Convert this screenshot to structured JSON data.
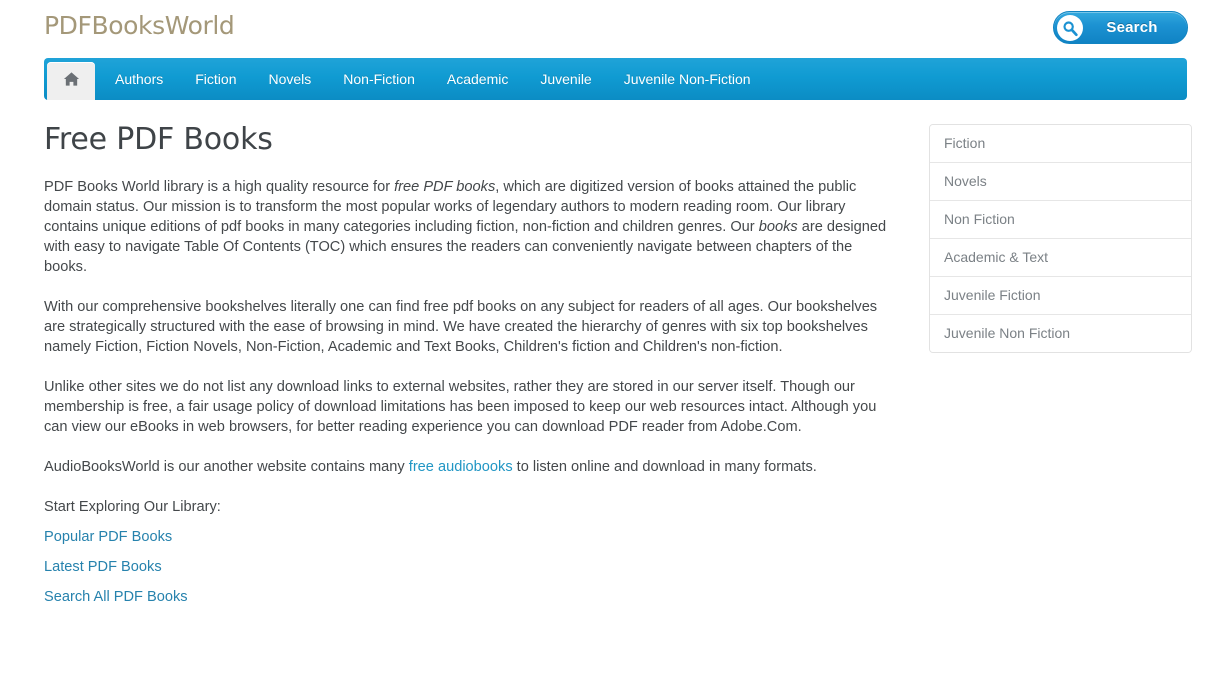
{
  "site": {
    "logo_text": "PDFBooksWorld"
  },
  "header": {
    "search_label": "Search",
    "search_icon": "search-icon"
  },
  "nav": {
    "home_icon": "home-icon",
    "items": [
      {
        "label": "Authors"
      },
      {
        "label": "Fiction"
      },
      {
        "label": "Novels"
      },
      {
        "label": "Non-Fiction"
      },
      {
        "label": "Academic"
      },
      {
        "label": "Juvenile"
      },
      {
        "label": "Juvenile Non-Fiction"
      }
    ]
  },
  "main": {
    "title": "Free PDF Books",
    "paragraph1": {
      "part1": "PDF Books World library is a high quality resource for ",
      "em1": "free PDF books",
      "part2": ", which are digitized version of books attained the public domain status. Our mission is to transform the most popular works of legendary authors to modern reading room. Our library contains unique editions of pdf books in many categories including fiction, non-fiction and children genres.  Our ",
      "em2": "books",
      "part3": " are designed with easy to navigate Table Of Contents (TOC) which ensures the readers can conveniently navigate between chapters of the books."
    },
    "paragraph2": "With our comprehensive bookshelves literally one can find free pdf books on any subject for readers of all ages. Our bookshelves are strategically structured with the ease of browsing in mind. We have created the hierarchy of genres with six top bookshelves namely Fiction, Fiction Novels, Non-Fiction, Academic and Text Books, Children's fiction and Children's non-fiction.",
    "paragraph3": "Unlike other sites we do not list any download links to external websites, rather they are stored in our server itself. Though our membership is free, a fair usage policy of download limitations has been imposed to keep our web resources intact. Although you can view our eBooks in web browsers, for better reading experience you can download PDF reader from Adobe.Com.",
    "paragraph4": {
      "part1": "AudioBooksWorld is our another website contains many ",
      "link": "free audiobooks",
      "part2": " to listen online and download in many formats."
    },
    "explore_label": "Start Exploring Our Library:",
    "explore_links": [
      {
        "label": "Popular PDF Books"
      },
      {
        "label": "Latest PDF Books"
      },
      {
        "label": "Search All PDF Books"
      }
    ]
  },
  "sidebar": {
    "items": [
      {
        "label": "Fiction"
      },
      {
        "label": "Novels"
      },
      {
        "label": "Non Fiction"
      },
      {
        "label": "Academic & Text"
      },
      {
        "label": "Juvenile Fiction"
      },
      {
        "label": "Juvenile Non Fiction"
      }
    ]
  },
  "colors": {
    "nav_blue": "#109bd2",
    "logo_tan": "#a49879",
    "link_blue": "#2682ad",
    "inline_link_blue": "#2196c4",
    "sidebar_text": "#7b8186",
    "body_text": "#44484b"
  }
}
